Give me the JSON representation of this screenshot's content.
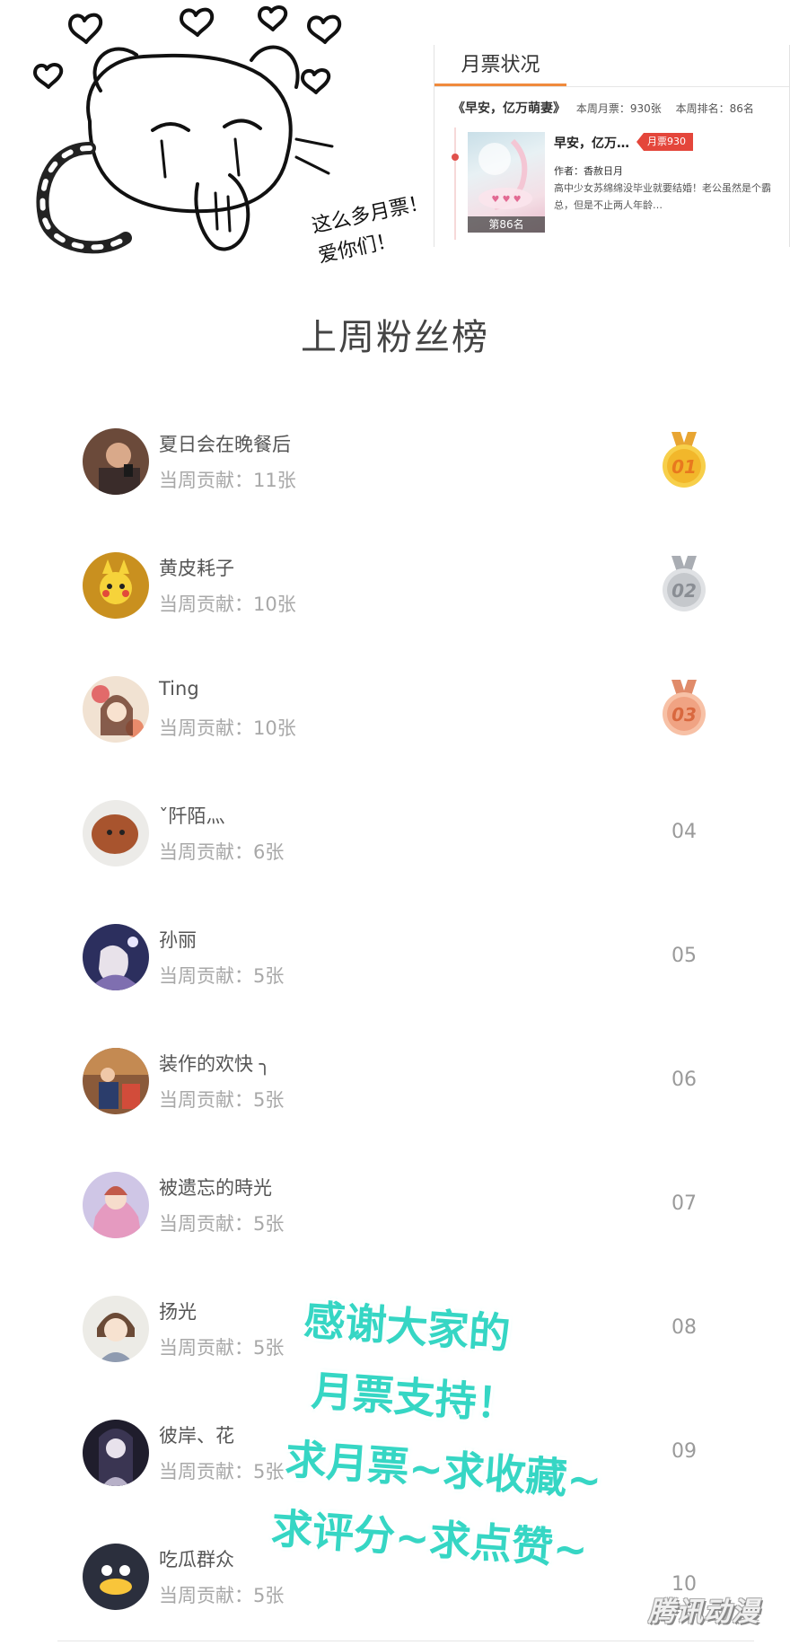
{
  "doodle": {
    "caption_line1": "这么多月票！",
    "caption_line2": "爱你们！"
  },
  "panel": {
    "tab_label": "月票状况",
    "book_title": "《早安，亿万萌妻》",
    "weekly_tickets": "本周月票：930张",
    "weekly_rank": "本周排名：86名",
    "card_title": "早安，亿万…",
    "ticket_badge": "月票930",
    "author": "作者：香赦日月",
    "description": "高中少女苏绵绵没毕业就要结婚！老公虽然是个霸总，但是不止两人年龄…",
    "cover_rank": "第86名"
  },
  "ranking": {
    "title": "上周粉丝榜",
    "fans": [
      {
        "name": "夏日会在晚餐后",
        "contribution": "当周贡献：11张",
        "rank": "01",
        "avatar": "photo-man"
      },
      {
        "name": "黄皮耗子",
        "contribution": "当周贡献：10张",
        "rank": "02",
        "avatar": "pikachu"
      },
      {
        "name": "Ting",
        "contribution": "当周贡献：10张",
        "rank": "03",
        "avatar": "anime-girl-flowers"
      },
      {
        "name": "ˇ阡陌灬",
        "contribution": "当周贡献：6张",
        "rank": "04",
        "avatar": "poodle"
      },
      {
        "name": "孙丽",
        "contribution": "当周贡献：5张",
        "rank": "05",
        "avatar": "girl-night"
      },
      {
        "name": "装作的欢快 ╮",
        "contribution": "当周贡献：5张",
        "rank": "06",
        "avatar": "photo-group"
      },
      {
        "name": "被遗忘的時光",
        "contribution": "当周贡献：5张",
        "rank": "07",
        "avatar": "anime-fairy"
      },
      {
        "name": "扬光",
        "contribution": "当周贡献：5张",
        "rank": "08",
        "avatar": "anime-boy"
      },
      {
        "name": "彼岸、花",
        "contribution": "当周贡献：5张",
        "rank": "09",
        "avatar": "dark-girl"
      },
      {
        "name": "吃瓜群众",
        "contribution": "当周贡献：5张",
        "rank": "10",
        "avatar": "default-penguin"
      }
    ]
  },
  "overlay": {
    "line1": "感谢大家的",
    "line2": "月票支持！",
    "line3": "求月票~求收藏~",
    "line4": "求评分~求点赞~"
  },
  "watermark": "腾讯动漫",
  "colors": {
    "accent_orange": "#f08a3c",
    "badge_red": "#e4463b",
    "overlay_teal": "#36d6c4",
    "gold": "#f2b72b",
    "silver": "#c5c8cc",
    "bronze": "#f0a383"
  }
}
